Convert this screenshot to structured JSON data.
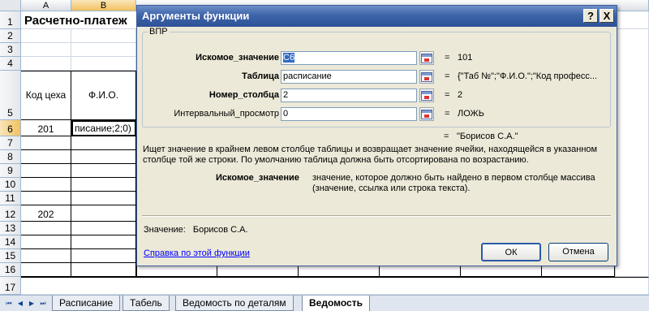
{
  "sheet": {
    "columns": [
      "A",
      "B"
    ],
    "rows": [
      "1",
      "2",
      "3",
      "4",
      "5",
      "6",
      "7",
      "8",
      "9",
      "10",
      "11",
      "12",
      "13",
      "14",
      "15",
      "16",
      "17"
    ],
    "title_cell": "Расчетно-платеж",
    "header_a": "Код цеха",
    "header_b": "Ф.И.О.",
    "a6": "201",
    "b6": "писание;2;0)",
    "a12": "202"
  },
  "tabs": {
    "nav": [
      "⏮",
      "◀",
      "▶",
      "⏭"
    ],
    "items": [
      "Расписание",
      "Табель",
      "Ведомость по деталям",
      "Ведомость"
    ],
    "active_index": 3
  },
  "dialog": {
    "title": "Аргументы функции",
    "help_btn": "?",
    "close_btn": "X",
    "function_name": "ВПР",
    "args": [
      {
        "label": "Искомое_значение",
        "bold": true,
        "input": "C6",
        "eq": "=",
        "value": "101"
      },
      {
        "label": "Таблица",
        "bold": true,
        "input": "расписание",
        "eq": "=",
        "value": "{\"Таб №\";\"Ф.И.О.\";\"Код професс..."
      },
      {
        "label": "Номер_столбца",
        "bold": true,
        "input": "2",
        "eq": "=",
        "value": "2"
      },
      {
        "label": "Интервальный_просмотр",
        "bold": false,
        "input": "0",
        "eq": "=",
        "value": "ЛОЖЬ"
      }
    ],
    "result_eq": "=",
    "result_value": "\"Борисов С.А.\"",
    "description": "Ищет значение в крайнем левом столбце таблицы и возвращает значение ячейки, находящейся в указанном столбце той же строки. По умолчанию таблица должна быть отсортирована по возрастанию.",
    "arg_name": "Искомое_значение",
    "arg_description": "значение, которое должно быть найдено в первом столбце массива (значение, ссылка или строка текста).",
    "value_label": "Значение:",
    "value_text": "Борисов С.А.",
    "help_link": "Справка по этой функции",
    "ok_label": "ОК",
    "cancel_label": "Отмена"
  }
}
